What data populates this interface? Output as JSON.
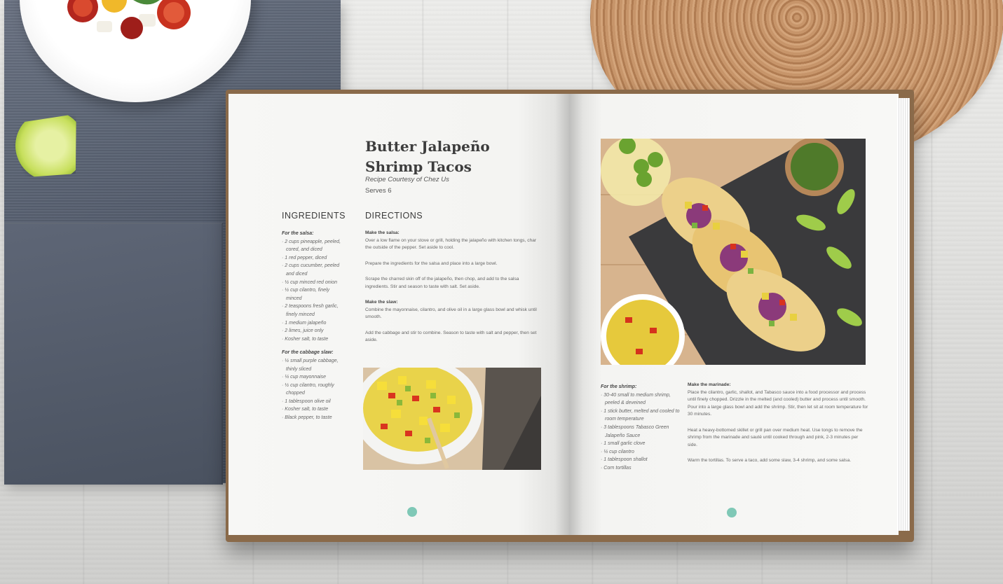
{
  "recipe": {
    "title": "Butter Jalapeño Shrimp Tacos",
    "credit": "Recipe Courtesy of Chez Us",
    "serves": "Serves 6"
  },
  "ingredients": {
    "heading": "INGREDIENTS",
    "salsa_label": "For the salsa:",
    "salsa_items": [
      "2 cups pineapple, peeled, cored, and diced",
      "1 red pepper, diced",
      "2 cups cucumber, peeled and diced",
      "½ cup minced red onion",
      "½ cup cilantro, finely minced",
      "2 teaspoons fresh garlic, finely minced",
      "1 medium jalapeño",
      "2 limes, juice only",
      "Kosher salt, to taste"
    ],
    "slaw_label": "For the cabbage slaw:",
    "slaw_items": [
      "½ small purple cabbage, thinly sliced",
      "¼ cup mayonnaise",
      "½ cup cilantro, roughly chopped",
      "1 tablespoon olive oil",
      "Kosher salt, to taste",
      "Black pepper, to taste"
    ],
    "shrimp_label": "For the shrimp:",
    "shrimp_items": [
      "30-40 small to medium shrimp, peeled & deveined",
      "1 stick butter, melted and cooled to room temperature",
      "3 tablespoons Tabasco Green Jalapeño Sauce",
      "1 small garlic clove",
      "¼ cup cilantro",
      "1 tablespoon shallot",
      "Corn tortillas"
    ]
  },
  "directions": {
    "heading": "DIRECTIONS",
    "salsa_label": "Make the salsa:",
    "salsa_p1": "Over a low flame on your stove or grill, holding the jalapeño with kitchen tongs, char the outside of the pepper. Set aside to cool.",
    "salsa_p2": "Prepare the ingredients for the salsa and place into a large bowl.",
    "salsa_p3": "Scrape the charred skin off of the jalapeño, then chop, and add to the salsa ingredients. Stir and season to taste with salt. Set aside.",
    "slaw_label": "Make the slaw:",
    "slaw_p1": "Combine the mayonnaise, cilantro, and olive oil in a large glass bowl and whisk until smooth.",
    "slaw_p2": "Add the cabbage and stir to combine. Season to taste with salt and pepper, then set aside.",
    "marinade_label": "Make the marinade:",
    "marinade_p1": "Place the cilantro, garlic, shallot, and Tabasco sauce into a food processor and process until finely chopped. Drizzle in the melted (and cooled) butter and process until smooth. Pour into a large glass bowl and add the shrimp. Stir, then let sit at room temperature for 30 minutes.",
    "marinade_p2": "Heat a heavy-bottomed skillet or grill pan over medium heat. Use tongs to remove the shrimp from the marinade and sauté until cooked through and pink, 2-3 minutes per side.",
    "marinade_p3": "Warm the tortillas. To serve a taco, add some slaw, 3-4 shrimp, and some salsa."
  },
  "colors": {
    "accent": "#7fc8b6",
    "napkin": "#525b6b",
    "page": "#f6f6f4"
  }
}
